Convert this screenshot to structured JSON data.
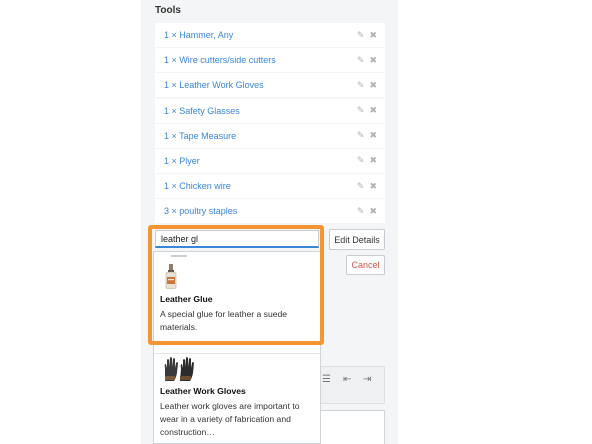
{
  "section": {
    "title": "Tools"
  },
  "tools": [
    {
      "label": "1 × Hammer, Any"
    },
    {
      "label": "1 × Wire cutters/side cutters"
    },
    {
      "label": "1 × Leather Work Gloves"
    },
    {
      "label": "1 × Safety Glasses"
    },
    {
      "label": "1 × Tape Measure"
    },
    {
      "label": "1 × Plyer"
    },
    {
      "label": "1 × Chicken wire"
    },
    {
      "label": "3 × poultry staples"
    }
  ],
  "icons": {
    "edit": "pencil-icon",
    "remove": "close-icon"
  },
  "search": {
    "value": "leather gl"
  },
  "buttons": {
    "edit_details": "Edit Details",
    "cancel": "Cancel"
  },
  "suggestions": [
    {
      "name": "Leather Glue",
      "description": "A special glue for leather a suede materials.",
      "icon": "glue-bottle-thumbnail"
    },
    {
      "name": "Leather Work Gloves",
      "description": "Leather work gloves are important to wear in a variety of fabrication and construction…",
      "icon": "gloves-thumbnail"
    }
  ],
  "colors": {
    "accent": "#3a86d9",
    "highlight": "#f39533",
    "danger": "#d9534f",
    "panel": "#f4f5f6"
  }
}
